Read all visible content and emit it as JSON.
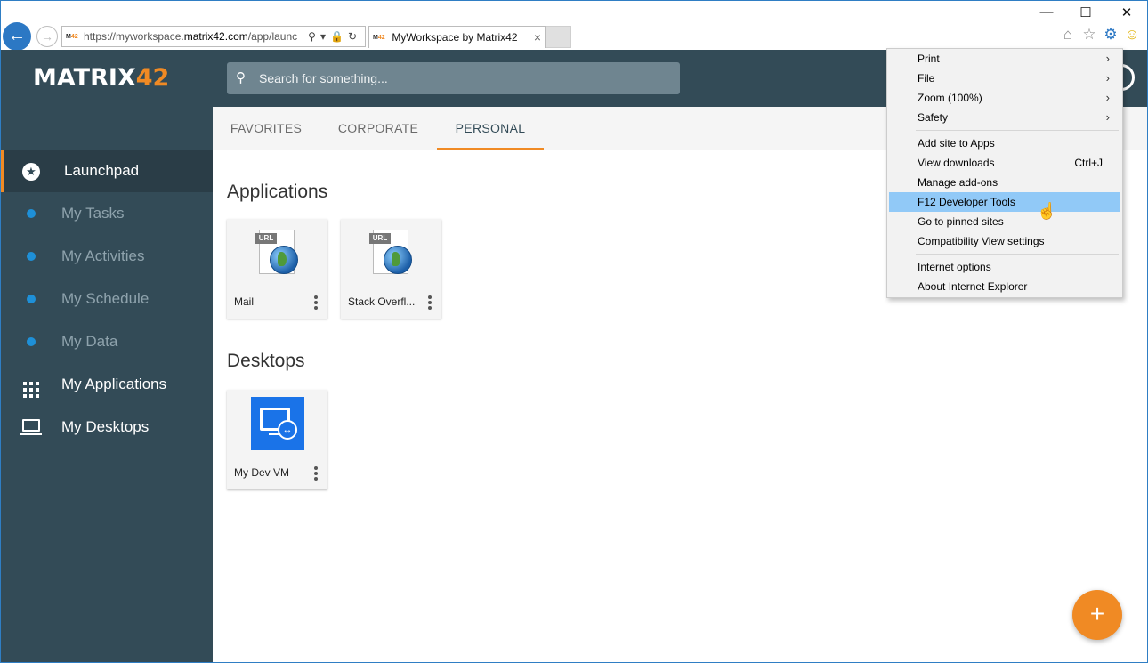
{
  "browser": {
    "address_prefix": "https://myworkspace.",
    "address_domain": "matrix42.com",
    "address_suffix": "/app/launc",
    "favicon_text_a": "M",
    "favicon_text_b": "42",
    "tab_title": "MyWorkspace by Matrix42",
    "tab_close": "×",
    "window_controls": {
      "minimize": "—",
      "maximize": "☐",
      "close": "✕"
    }
  },
  "app": {
    "logo_text": "MATRIX",
    "logo_number": "42",
    "search_placeholder": "Search for something...",
    "accent_color": "#f08a24",
    "sidebar_color": "#334b57"
  },
  "sidebar": {
    "items": [
      {
        "label": "Launchpad",
        "icon": "star-circle-icon",
        "active": true
      },
      {
        "label": "My Tasks",
        "icon": "dot-icon"
      },
      {
        "label": "My Activities",
        "icon": "dot-icon"
      },
      {
        "label": "My Schedule",
        "icon": "dot-icon"
      },
      {
        "label": "My Data",
        "icon": "dot-icon"
      },
      {
        "label": "My Applications",
        "icon": "grid-icon"
      },
      {
        "label": "My Desktops",
        "icon": "laptop-icon"
      }
    ]
  },
  "tabs": [
    {
      "label": "FAVORITES"
    },
    {
      "label": "CORPORATE"
    },
    {
      "label": "PERSONAL",
      "active": true
    }
  ],
  "sections": {
    "applications": {
      "title": "Applications",
      "tiles": [
        {
          "label": "Mail",
          "icon_tag": "URL"
        },
        {
          "label": "Stack Overfl...",
          "icon_tag": "URL"
        }
      ]
    },
    "desktops": {
      "title": "Desktops",
      "tiles": [
        {
          "label": "My Dev VM"
        }
      ]
    }
  },
  "fab_label": "+",
  "context_menu": {
    "items": [
      {
        "label": "Print",
        "submenu": true
      },
      {
        "label": "File",
        "submenu": true
      },
      {
        "label": "Zoom (100%)",
        "submenu": true
      },
      {
        "label": "Safety",
        "submenu": true
      },
      {
        "label": "Add site to Apps"
      },
      {
        "label": "View downloads",
        "shortcut": "Ctrl+J"
      },
      {
        "label": "Manage add-ons"
      },
      {
        "label": "F12 Developer Tools",
        "highlighted": true
      },
      {
        "label": "Go to pinned sites"
      },
      {
        "label": "Compatibility View settings"
      },
      {
        "label": "Internet options"
      },
      {
        "label": "About Internet Explorer"
      }
    ],
    "submenu_arrow": "›"
  }
}
